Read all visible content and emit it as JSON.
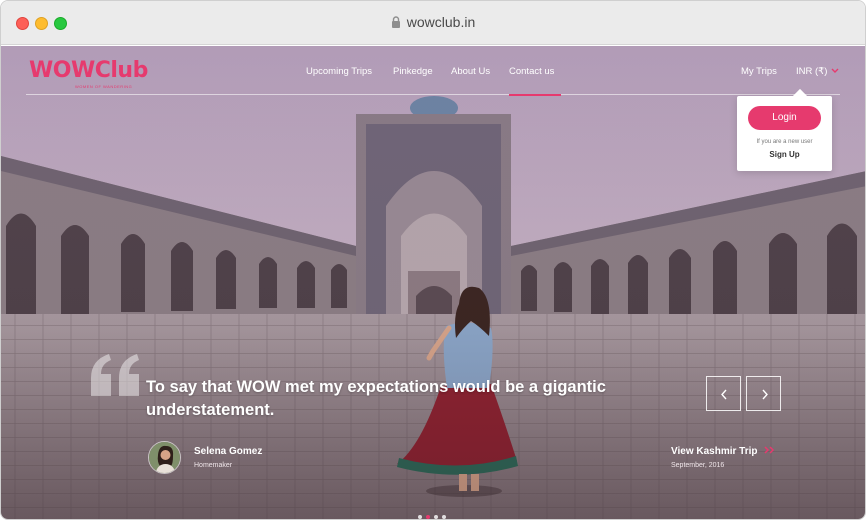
{
  "browser": {
    "url": "wowclub.in"
  },
  "header": {
    "logo_text": "WOWClub",
    "logo_subtitle": "WOMEN OF WANDERING",
    "nav": [
      "Upcoming Trips",
      "Pinkedge",
      "About Us",
      "Contact us"
    ],
    "active_nav": "Contact us",
    "my_trips": "My Trips",
    "currency": "INR (₹)"
  },
  "login_popup": {
    "login_label": "Login",
    "new_user_text": "If you are a new user",
    "signup_label": "Sign Up"
  },
  "testimonial": {
    "quote": "To say that WOW met my expectations would be a gigantic understatement.",
    "author_name": "Selena Gomez",
    "author_role": "Homemaker",
    "trip_link": "View Kashmir Trip",
    "trip_date": "September, 2016"
  },
  "carousel": {
    "slides": 4,
    "active_index": 1
  },
  "colors": {
    "accent": "#e63a6e"
  },
  "icons": [
    "lock-icon",
    "chevron-down-icon",
    "quote-icon",
    "chevron-left-icon",
    "chevron-right-icon",
    "double-chevron-right-icon"
  ]
}
